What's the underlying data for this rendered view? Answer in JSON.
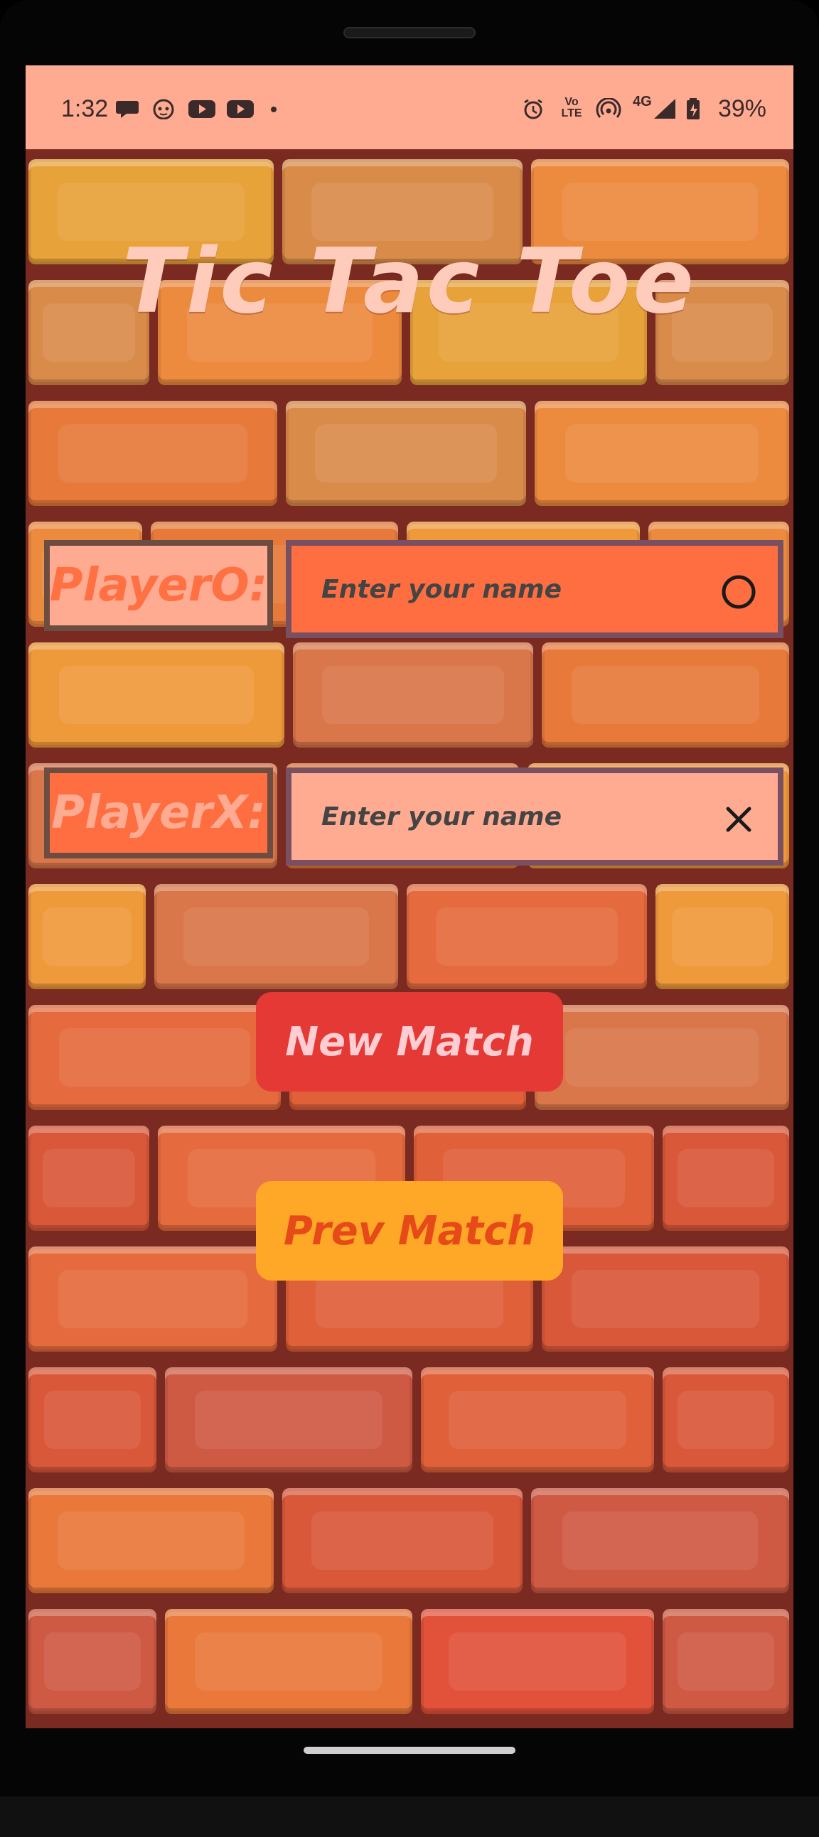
{
  "status_bar": {
    "time": "1:32",
    "battery": "39%",
    "icons_left": [
      "chat-icon",
      "cat-face-icon",
      "youtube-icon",
      "youtube-icon",
      "dot-icon"
    ],
    "icons_right": [
      "alarm-icon",
      "volte-icon",
      "hotspot-icon",
      "4g-signal-icon",
      "battery-charging-icon"
    ],
    "volte_label": "Vo LTE",
    "network_label": "4G"
  },
  "app": {
    "title": "Tic Tac Toe",
    "player_o": {
      "label": "PlayerO:",
      "placeholder": "Enter your name",
      "value": "",
      "icon": "circle-icon"
    },
    "player_x": {
      "label": "PlayerX:",
      "placeholder": "Enter your name",
      "value": "",
      "icon": "x-icon"
    },
    "new_match_label": "New Match",
    "prev_match_label": "Prev Match"
  },
  "colors": {
    "status_bar_bg": "#ffab91",
    "title_text": "#ffccbc",
    "player_o_label_bg": "#ffab91",
    "player_o_label_text": "#ff7043",
    "player_o_input_bg": "#ff6e40",
    "player_x_label_bg": "#ff6e40",
    "player_x_label_text": "#ffab91",
    "player_x_input_bg": "#ffab91",
    "new_match_bg": "#e53935",
    "new_match_text": "#ffcdd2",
    "prev_match_bg": "#ffa726",
    "prev_match_text": "#e64a19"
  }
}
